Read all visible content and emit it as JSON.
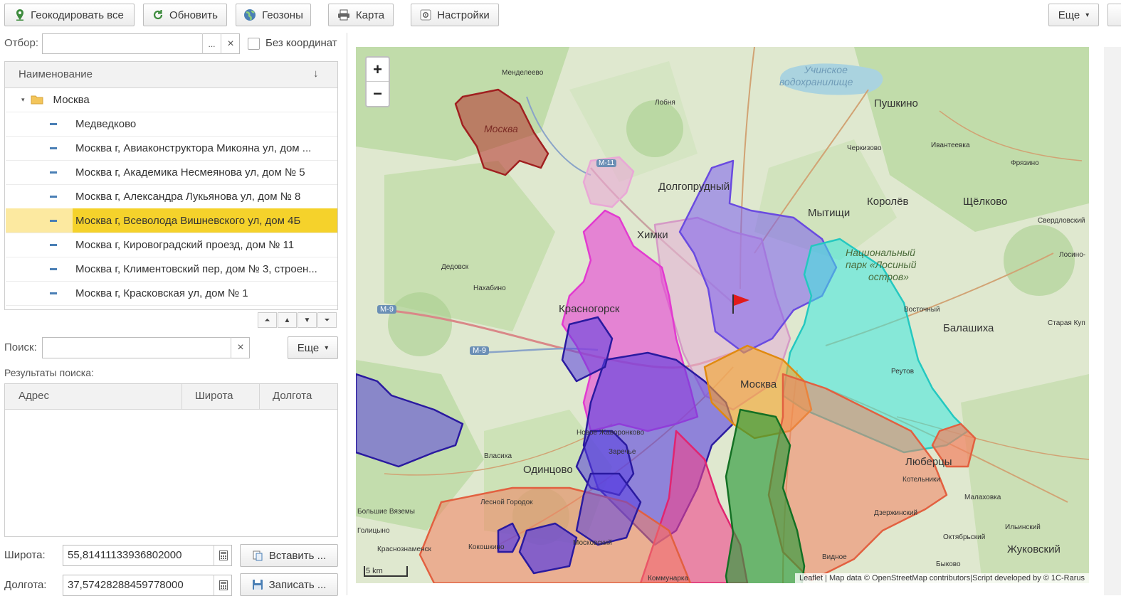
{
  "toolbar": {
    "geocode_all": "Геокодировать все",
    "refresh": "Обновить",
    "geozones": "Геозоны",
    "map": "Карта",
    "settings": "Настройки",
    "more": "Еще"
  },
  "filter": {
    "label": "Отбор:",
    "value": "",
    "ellipsis": "...",
    "clear": "×",
    "no_coords_label": "Без координат",
    "no_coords_checked": false
  },
  "tree": {
    "column_header": "Наименование",
    "sort_indicator": "↓",
    "group": "Москва",
    "items": [
      {
        "label": "Медведково"
      },
      {
        "label": "Москва г, Авиаконструктора Микояна ул, дом ..."
      },
      {
        "label": "Москва г, Академика Несмеянова ул, дом № 5"
      },
      {
        "label": "Москва г, Александра Лукьянова ул, дом № 8"
      },
      {
        "label": "Москва г, Всеволода Вишневского ул, дом 4Б",
        "selected": true
      },
      {
        "label": "Москва г, Кировоградский проезд, дом № 11"
      },
      {
        "label": "Москва г, Климентовский пер, дом № 3, строен..."
      },
      {
        "label": "Москва г, Красковская ул, дом № 1"
      }
    ],
    "nav": {
      "first": "⏶",
      "up": "▲",
      "down": "▼",
      "last": "⏷"
    }
  },
  "search": {
    "label": "Поиск:",
    "value": "",
    "clear": "×",
    "more": "Еще"
  },
  "results": {
    "title": "Результаты поиска:",
    "col_address": "Адрес",
    "col_lat": "Широта",
    "col_lon": "Долгота",
    "rows": []
  },
  "coords": {
    "lat_label": "Широта:",
    "lat_value": "55,81411133936802000",
    "lon_label": "Долгота:",
    "lon_value": "37,57428288459778000",
    "insert_btn": "Вставить ...",
    "save_btn": "Записать ..."
  },
  "map": {
    "zoom_in": "+",
    "zoom_out": "−",
    "scale": "5 km",
    "attribution": "Leaflet | Map data © OpenStreetMap contributors|Script developed by © 1C-Rarus",
    "labels": {
      "moscow_center": "Москва",
      "moscow_zone": "Москва",
      "mendeleevo": "Менделеево",
      "lobnya": "Лобня",
      "reservoir1": "Учинское",
      "reservoir2": "водохранилище",
      "pushkino": "Пушкино",
      "ivanteevka": "Ивантеевка",
      "cherkizovo": "Черкизово",
      "fryazino": "Фрязино",
      "dolgoprudny": "Долгопрудный",
      "mytishchi": "Мытищи",
      "korolev": "Королёв",
      "shchelkovo": "Щёлково",
      "sverdlovsky": "Свердловский",
      "khimki": "Химки",
      "natpark1": "Национальный",
      "natpark2": "парк «Лосиный",
      "natpark3": "остров»",
      "losino": "Лосино-",
      "dedovsk": "Дедовск",
      "nakhabino": "Нахабино",
      "krasnogorsk": "Красногорск",
      "vostochny": "Восточный",
      "balashikha": "Балашиха",
      "staraya_kupavna": "Старая Куп",
      "reutov": "Реутов",
      "m9_a": "М-9",
      "m9_b": "М-9",
      "m11": "М-11",
      "novoe_zhavoronkovo": "Новое Жаворонково",
      "zarechye": "Заречье",
      "vlasikha": "Власиха",
      "odintsovo": "Одинцово",
      "lyubertsy": "Люберцы",
      "kotelniki": "Котельники",
      "malakhovka": "Малаховка",
      "lesnoy_gorodok": "Лесной Городок",
      "bolshie_vyazemy": "Большие Вяземы",
      "golitsyno": "Голицыно",
      "dzerzhinsky": "Дзержинский",
      "oktyabrsky": "Октябрьский",
      "ilyinsky": "Ильинский",
      "zhukovsky": "Жуковский",
      "krasnoznamensk": "Краснознаменск",
      "kokoshkino": "Кокошкино",
      "moskovsky": "Московский",
      "kommunarka": "Коммунарка",
      "vidnoe": "Видное",
      "bykovo": "Быково"
    },
    "zone_colors": {
      "nw_red": "#b5302a",
      "pink": "#e83fd6",
      "violet": "#7a5cf0",
      "blue_violet": "#5a3fe0",
      "cyan": "#3de8e0",
      "orange": "#f5a32a",
      "salmon": "#f28060",
      "green": "#2c9a3a",
      "light_pink": "#e9a8d6",
      "magenta": "#f0458a"
    }
  }
}
